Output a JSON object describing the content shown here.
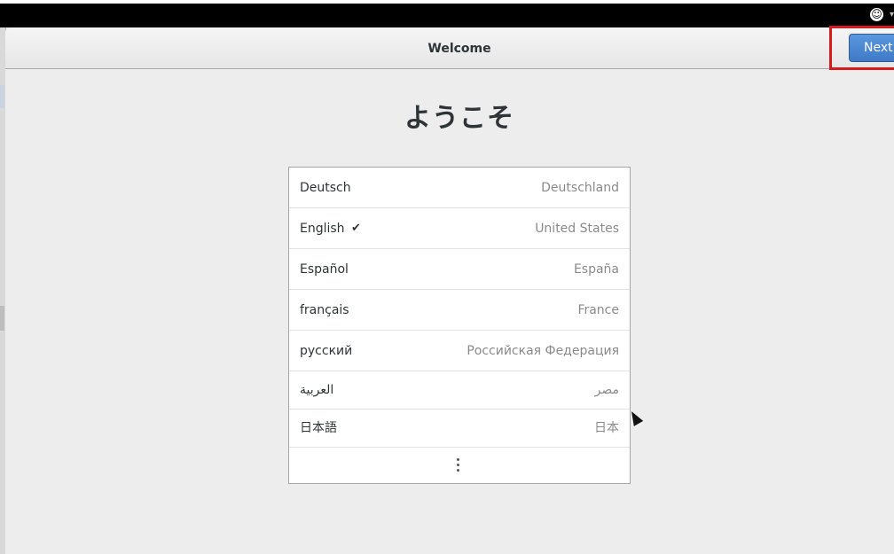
{
  "topbar": {
    "accessibility_icon": "accessibility-icon",
    "accessibility_caret": "▾"
  },
  "window": {
    "header_title": "Welcome",
    "next_label": "Next"
  },
  "page": {
    "title": "ようこそ"
  },
  "languages": [
    {
      "name": "Deutsch",
      "region": "Deutschland",
      "selected": false
    },
    {
      "name": "English",
      "region": "United States",
      "selected": true
    },
    {
      "name": "Español",
      "region": "España",
      "selected": false
    },
    {
      "name": "français",
      "region": "France",
      "selected": false
    },
    {
      "name": "русский",
      "region": "Российская Федерация",
      "selected": false
    },
    {
      "name": "العربية",
      "region": "مصر",
      "selected": false
    },
    {
      "name": "日本語",
      "region": "日本",
      "selected": false
    }
  ],
  "check_glyph": "✔",
  "more_icon": "more-vertical-icon",
  "colors": {
    "accent": "#3e7ac7",
    "highlight": "#d51b1b"
  }
}
